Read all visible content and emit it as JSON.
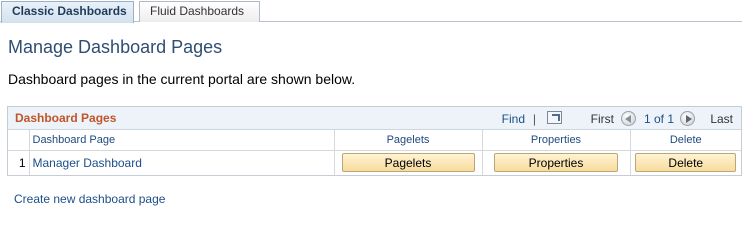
{
  "tabs": [
    {
      "label": "Classic Dashboards",
      "active": true
    },
    {
      "label": "Fluid Dashboards",
      "active": false
    }
  ],
  "page_title": "Manage Dashboard Pages",
  "description": "Dashboard pages in the current portal are shown below.",
  "grid": {
    "title": "Dashboard Pages",
    "nav": {
      "find": "Find",
      "pipe": "|",
      "first": "First",
      "count": "1 of 1",
      "last": "Last"
    },
    "columns": [
      "Dashboard Page",
      "Pagelets",
      "Properties",
      "Delete"
    ],
    "rows": [
      {
        "num": "1",
        "page": "Manager Dashboard",
        "pagelets_button": "Pagelets",
        "properties_button": "Properties",
        "delete_button": "Delete"
      }
    ]
  },
  "create_link": "Create new dashboard page",
  "colors": {
    "title": "#2e4e73",
    "link": "#1d4e89",
    "grid_title": "#c0552a",
    "button": "#f7dc9c"
  }
}
